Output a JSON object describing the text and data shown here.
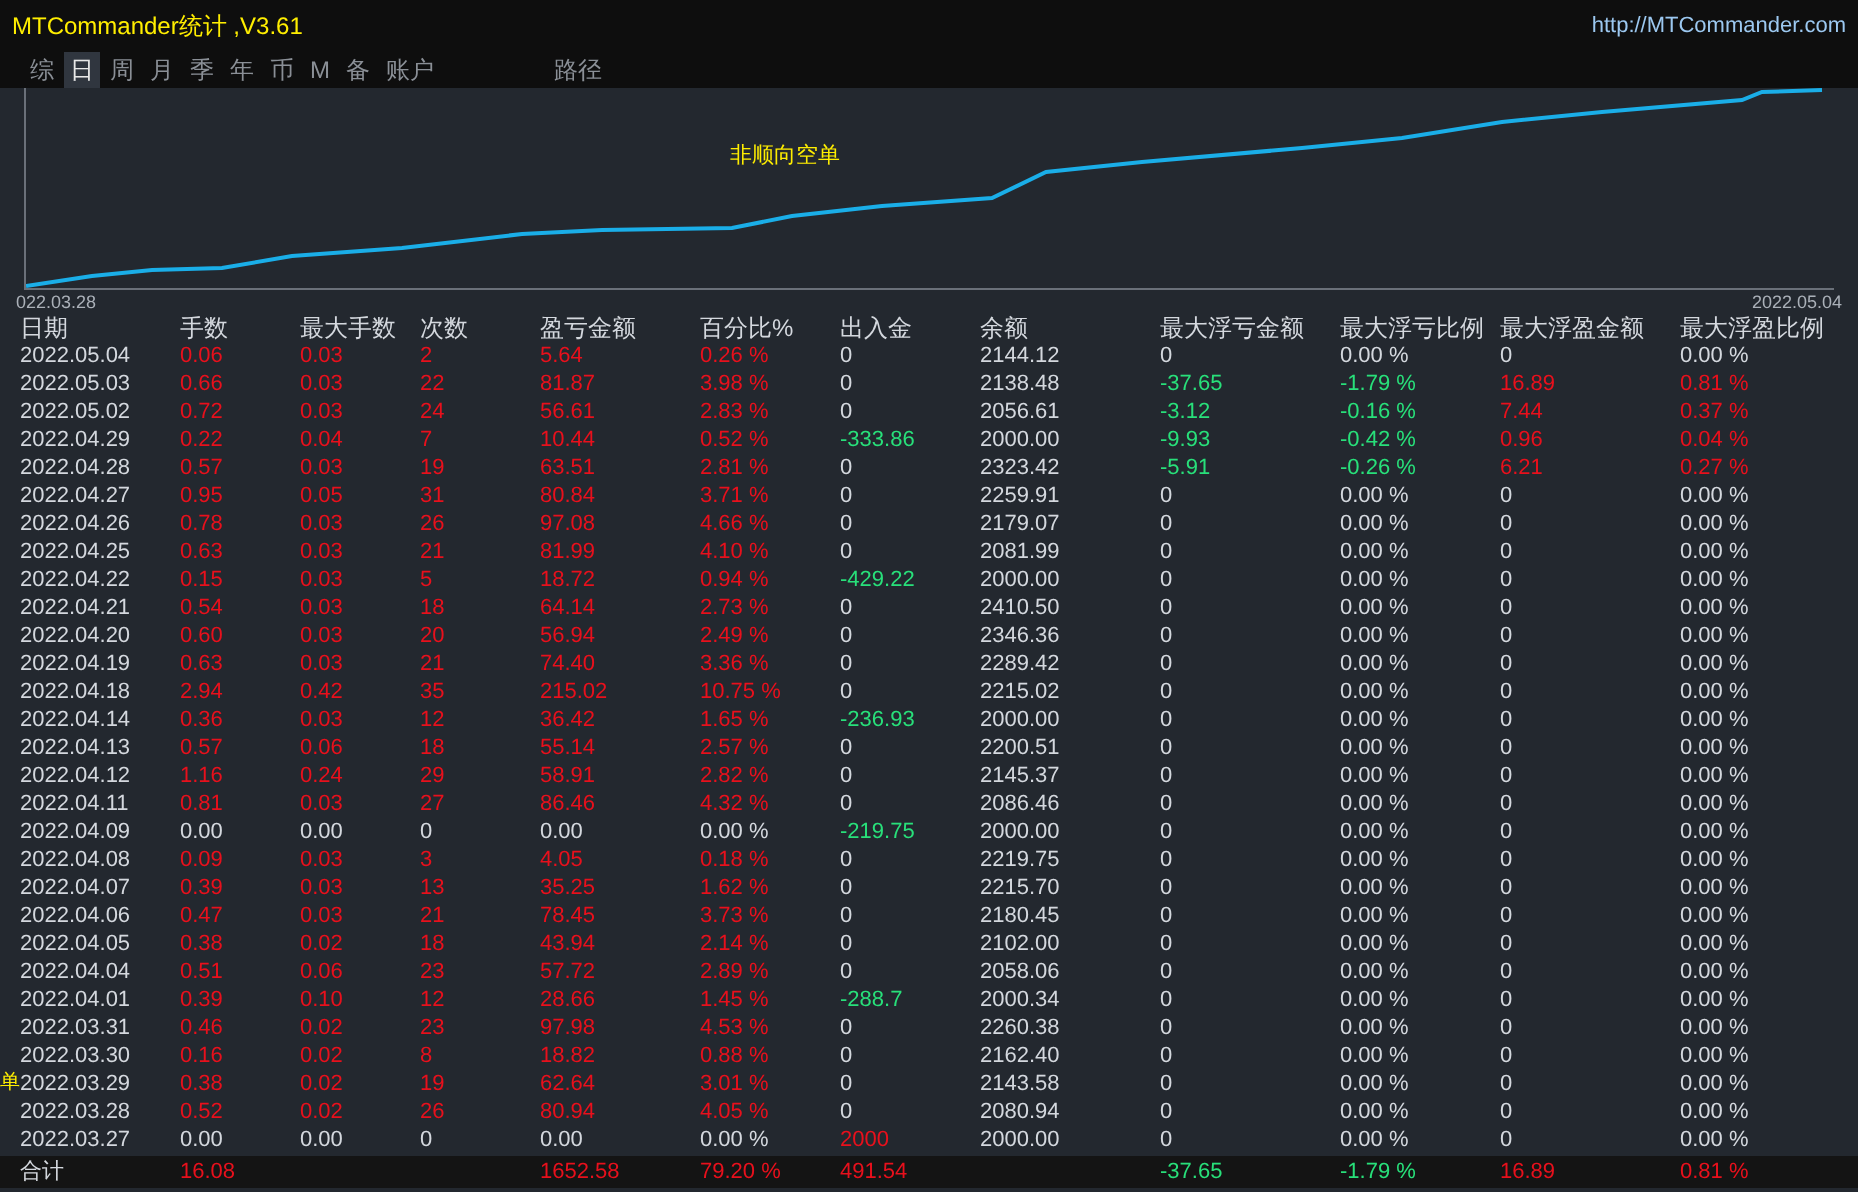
{
  "window": {
    "title": "MTCommander统计 ,V3.61",
    "url": "http://MTCommander.com"
  },
  "tabs": [
    {
      "label": "综",
      "selected": false
    },
    {
      "label": "日",
      "selected": true
    },
    {
      "label": "周",
      "selected": false
    },
    {
      "label": "月",
      "selected": false
    },
    {
      "label": "季",
      "selected": false
    },
    {
      "label": "年",
      "selected": false
    },
    {
      "label": "币",
      "selected": false
    },
    {
      "label": "M",
      "selected": false
    },
    {
      "label": "备",
      "selected": false
    },
    {
      "label": "账户",
      "selected": false
    },
    {
      "label": "路径",
      "selected": false
    }
  ],
  "chart": {
    "title": "非顺向空单",
    "start_date": "022.03.28",
    "end_date": "2022.05.04",
    "side_mark": "单"
  },
  "table": {
    "columns": [
      "日期",
      "手数",
      "最大手数",
      "次数",
      "盈亏金额",
      "百分比%",
      "出入金",
      "余额",
      "最大浮亏金额",
      "最大浮亏比例",
      "最大浮盈金额",
      "最大浮盈比例"
    ],
    "rows": [
      {
        "cells": [
          {
            "text": "2022.05.04",
            "color": "#d4d8de"
          },
          {
            "text": "0.06",
            "color": "#e8101c"
          },
          {
            "text": "0.03",
            "color": "#e8101c"
          },
          {
            "text": "2",
            "color": "#e8101c"
          },
          {
            "text": "5.64",
            "color": "#e8101c"
          },
          {
            "text": "0.26 %",
            "color": "#e8101c"
          },
          {
            "text": "0",
            "color": "#d4d8de"
          },
          {
            "text": "2144.12",
            "color": "#d4d8de"
          },
          {
            "text": "0",
            "color": "#d4d8de"
          },
          {
            "text": "0.00 %",
            "color": "#d4d8de"
          },
          {
            "text": "0",
            "color": "#d4d8de"
          },
          {
            "text": "0.00 %",
            "color": "#d4d8de"
          }
        ]
      },
      {
        "cells": [
          {
            "text": "2022.05.03",
            "color": "#d4d8de"
          },
          {
            "text": "0.66",
            "color": "#e8101c"
          },
          {
            "text": "0.03",
            "color": "#e8101c"
          },
          {
            "text": "22",
            "color": "#e8101c"
          },
          {
            "text": "81.87",
            "color": "#e8101c"
          },
          {
            "text": "3.98 %",
            "color": "#e8101c"
          },
          {
            "text": "0",
            "color": "#d4d8de"
          },
          {
            "text": "2138.48",
            "color": "#d4d8de"
          },
          {
            "text": "-37.65",
            "color": "#28e07a"
          },
          {
            "text": "-1.79 %",
            "color": "#28e07a"
          },
          {
            "text": "16.89",
            "color": "#e8101c"
          },
          {
            "text": "0.81 %",
            "color": "#e8101c"
          }
        ]
      },
      {
        "cells": [
          {
            "text": "2022.05.02",
            "color": "#d4d8de"
          },
          {
            "text": "0.72",
            "color": "#e8101c"
          },
          {
            "text": "0.03",
            "color": "#e8101c"
          },
          {
            "text": "24",
            "color": "#e8101c"
          },
          {
            "text": "56.61",
            "color": "#e8101c"
          },
          {
            "text": "2.83 %",
            "color": "#e8101c"
          },
          {
            "text": "0",
            "color": "#d4d8de"
          },
          {
            "text": "2056.61",
            "color": "#d4d8de"
          },
          {
            "text": "-3.12",
            "color": "#28e07a"
          },
          {
            "text": "-0.16 %",
            "color": "#28e07a"
          },
          {
            "text": "7.44",
            "color": "#e8101c"
          },
          {
            "text": "0.37 %",
            "color": "#e8101c"
          }
        ]
      },
      {
        "cells": [
          {
            "text": "2022.04.29",
            "color": "#d4d8de"
          },
          {
            "text": "0.22",
            "color": "#e8101c"
          },
          {
            "text": "0.04",
            "color": "#e8101c"
          },
          {
            "text": "7",
            "color": "#e8101c"
          },
          {
            "text": "10.44",
            "color": "#e8101c"
          },
          {
            "text": "0.52 %",
            "color": "#e8101c"
          },
          {
            "text": "-333.86",
            "color": "#28e07a"
          },
          {
            "text": "2000.00",
            "color": "#d4d8de"
          },
          {
            "text": "-9.93",
            "color": "#28e07a"
          },
          {
            "text": "-0.42 %",
            "color": "#28e07a"
          },
          {
            "text": "0.96",
            "color": "#e8101c"
          },
          {
            "text": "0.04 %",
            "color": "#e8101c"
          }
        ]
      },
      {
        "cells": [
          {
            "text": "2022.04.28",
            "color": "#d4d8de"
          },
          {
            "text": "0.57",
            "color": "#e8101c"
          },
          {
            "text": "0.03",
            "color": "#e8101c"
          },
          {
            "text": "19",
            "color": "#e8101c"
          },
          {
            "text": "63.51",
            "color": "#e8101c"
          },
          {
            "text": "2.81 %",
            "color": "#e8101c"
          },
          {
            "text": "0",
            "color": "#d4d8de"
          },
          {
            "text": "2323.42",
            "color": "#d4d8de"
          },
          {
            "text": "-5.91",
            "color": "#28e07a"
          },
          {
            "text": "-0.26 %",
            "color": "#28e07a"
          },
          {
            "text": "6.21",
            "color": "#e8101c"
          },
          {
            "text": "0.27 %",
            "color": "#e8101c"
          }
        ]
      },
      {
        "cells": [
          {
            "text": "2022.04.27",
            "color": "#d4d8de"
          },
          {
            "text": "0.95",
            "color": "#e8101c"
          },
          {
            "text": "0.05",
            "color": "#e8101c"
          },
          {
            "text": "31",
            "color": "#e8101c"
          },
          {
            "text": "80.84",
            "color": "#e8101c"
          },
          {
            "text": "3.71 %",
            "color": "#e8101c"
          },
          {
            "text": "0",
            "color": "#d4d8de"
          },
          {
            "text": "2259.91",
            "color": "#d4d8de"
          },
          {
            "text": "0",
            "color": "#d4d8de"
          },
          {
            "text": "0.00 %",
            "color": "#d4d8de"
          },
          {
            "text": "0",
            "color": "#d4d8de"
          },
          {
            "text": "0.00 %",
            "color": "#d4d8de"
          }
        ]
      },
      {
        "cells": [
          {
            "text": "2022.04.26",
            "color": "#d4d8de"
          },
          {
            "text": "0.78",
            "color": "#e8101c"
          },
          {
            "text": "0.03",
            "color": "#e8101c"
          },
          {
            "text": "26",
            "color": "#e8101c"
          },
          {
            "text": "97.08",
            "color": "#e8101c"
          },
          {
            "text": "4.66 %",
            "color": "#e8101c"
          },
          {
            "text": "0",
            "color": "#d4d8de"
          },
          {
            "text": "2179.07",
            "color": "#d4d8de"
          },
          {
            "text": "0",
            "color": "#d4d8de"
          },
          {
            "text": "0.00 %",
            "color": "#d4d8de"
          },
          {
            "text": "0",
            "color": "#d4d8de"
          },
          {
            "text": "0.00 %",
            "color": "#d4d8de"
          }
        ]
      },
      {
        "cells": [
          {
            "text": "2022.04.25",
            "color": "#d4d8de"
          },
          {
            "text": "0.63",
            "color": "#e8101c"
          },
          {
            "text": "0.03",
            "color": "#e8101c"
          },
          {
            "text": "21",
            "color": "#e8101c"
          },
          {
            "text": "81.99",
            "color": "#e8101c"
          },
          {
            "text": "4.10 %",
            "color": "#e8101c"
          },
          {
            "text": "0",
            "color": "#d4d8de"
          },
          {
            "text": "2081.99",
            "color": "#d4d8de"
          },
          {
            "text": "0",
            "color": "#d4d8de"
          },
          {
            "text": "0.00 %",
            "color": "#d4d8de"
          },
          {
            "text": "0",
            "color": "#d4d8de"
          },
          {
            "text": "0.00 %",
            "color": "#d4d8de"
          }
        ]
      },
      {
        "cells": [
          {
            "text": "2022.04.22",
            "color": "#d4d8de"
          },
          {
            "text": "0.15",
            "color": "#e8101c"
          },
          {
            "text": "0.03",
            "color": "#e8101c"
          },
          {
            "text": "5",
            "color": "#e8101c"
          },
          {
            "text": "18.72",
            "color": "#e8101c"
          },
          {
            "text": "0.94 %",
            "color": "#e8101c"
          },
          {
            "text": "-429.22",
            "color": "#28e07a"
          },
          {
            "text": "2000.00",
            "color": "#d4d8de"
          },
          {
            "text": "0",
            "color": "#d4d8de"
          },
          {
            "text": "0.00 %",
            "color": "#d4d8de"
          },
          {
            "text": "0",
            "color": "#d4d8de"
          },
          {
            "text": "0.00 %",
            "color": "#d4d8de"
          }
        ]
      },
      {
        "cells": [
          {
            "text": "2022.04.21",
            "color": "#d4d8de"
          },
          {
            "text": "0.54",
            "color": "#e8101c"
          },
          {
            "text": "0.03",
            "color": "#e8101c"
          },
          {
            "text": "18",
            "color": "#e8101c"
          },
          {
            "text": "64.14",
            "color": "#e8101c"
          },
          {
            "text": "2.73 %",
            "color": "#e8101c"
          },
          {
            "text": "0",
            "color": "#d4d8de"
          },
          {
            "text": "2410.50",
            "color": "#d4d8de"
          },
          {
            "text": "0",
            "color": "#d4d8de"
          },
          {
            "text": "0.00 %",
            "color": "#d4d8de"
          },
          {
            "text": "0",
            "color": "#d4d8de"
          },
          {
            "text": "0.00 %",
            "color": "#d4d8de"
          }
        ]
      },
      {
        "cells": [
          {
            "text": "2022.04.20",
            "color": "#d4d8de"
          },
          {
            "text": "0.60",
            "color": "#e8101c"
          },
          {
            "text": "0.03",
            "color": "#e8101c"
          },
          {
            "text": "20",
            "color": "#e8101c"
          },
          {
            "text": "56.94",
            "color": "#e8101c"
          },
          {
            "text": "2.49 %",
            "color": "#e8101c"
          },
          {
            "text": "0",
            "color": "#d4d8de"
          },
          {
            "text": "2346.36",
            "color": "#d4d8de"
          },
          {
            "text": "0",
            "color": "#d4d8de"
          },
          {
            "text": "0.00 %",
            "color": "#d4d8de"
          },
          {
            "text": "0",
            "color": "#d4d8de"
          },
          {
            "text": "0.00 %",
            "color": "#d4d8de"
          }
        ]
      },
      {
        "cells": [
          {
            "text": "2022.04.19",
            "color": "#d4d8de"
          },
          {
            "text": "0.63",
            "color": "#e8101c"
          },
          {
            "text": "0.03",
            "color": "#e8101c"
          },
          {
            "text": "21",
            "color": "#e8101c"
          },
          {
            "text": "74.40",
            "color": "#e8101c"
          },
          {
            "text": "3.36 %",
            "color": "#e8101c"
          },
          {
            "text": "0",
            "color": "#d4d8de"
          },
          {
            "text": "2289.42",
            "color": "#d4d8de"
          },
          {
            "text": "0",
            "color": "#d4d8de"
          },
          {
            "text": "0.00 %",
            "color": "#d4d8de"
          },
          {
            "text": "0",
            "color": "#d4d8de"
          },
          {
            "text": "0.00 %",
            "color": "#d4d8de"
          }
        ]
      },
      {
        "cells": [
          {
            "text": "2022.04.18",
            "color": "#d4d8de"
          },
          {
            "text": "2.94",
            "color": "#e8101c"
          },
          {
            "text": "0.42",
            "color": "#e8101c"
          },
          {
            "text": "35",
            "color": "#e8101c"
          },
          {
            "text": "215.02",
            "color": "#e8101c"
          },
          {
            "text": "10.75 %",
            "color": "#e8101c"
          },
          {
            "text": "0",
            "color": "#d4d8de"
          },
          {
            "text": "2215.02",
            "color": "#d4d8de"
          },
          {
            "text": "0",
            "color": "#d4d8de"
          },
          {
            "text": "0.00 %",
            "color": "#d4d8de"
          },
          {
            "text": "0",
            "color": "#d4d8de"
          },
          {
            "text": "0.00 %",
            "color": "#d4d8de"
          }
        ]
      },
      {
        "cells": [
          {
            "text": "2022.04.14",
            "color": "#d4d8de"
          },
          {
            "text": "0.36",
            "color": "#e8101c"
          },
          {
            "text": "0.03",
            "color": "#e8101c"
          },
          {
            "text": "12",
            "color": "#e8101c"
          },
          {
            "text": "36.42",
            "color": "#e8101c"
          },
          {
            "text": "1.65 %",
            "color": "#e8101c"
          },
          {
            "text": "-236.93",
            "color": "#28e07a"
          },
          {
            "text": "2000.00",
            "color": "#d4d8de"
          },
          {
            "text": "0",
            "color": "#d4d8de"
          },
          {
            "text": "0.00 %",
            "color": "#d4d8de"
          },
          {
            "text": "0",
            "color": "#d4d8de"
          },
          {
            "text": "0.00 %",
            "color": "#d4d8de"
          }
        ]
      },
      {
        "cells": [
          {
            "text": "2022.04.13",
            "color": "#d4d8de"
          },
          {
            "text": "0.57",
            "color": "#e8101c"
          },
          {
            "text": "0.06",
            "color": "#e8101c"
          },
          {
            "text": "18",
            "color": "#e8101c"
          },
          {
            "text": "55.14",
            "color": "#e8101c"
          },
          {
            "text": "2.57 %",
            "color": "#e8101c"
          },
          {
            "text": "0",
            "color": "#d4d8de"
          },
          {
            "text": "2200.51",
            "color": "#d4d8de"
          },
          {
            "text": "0",
            "color": "#d4d8de"
          },
          {
            "text": "0.00 %",
            "color": "#d4d8de"
          },
          {
            "text": "0",
            "color": "#d4d8de"
          },
          {
            "text": "0.00 %",
            "color": "#d4d8de"
          }
        ]
      },
      {
        "cells": [
          {
            "text": "2022.04.12",
            "color": "#d4d8de"
          },
          {
            "text": "1.16",
            "color": "#e8101c"
          },
          {
            "text": "0.24",
            "color": "#e8101c"
          },
          {
            "text": "29",
            "color": "#e8101c"
          },
          {
            "text": "58.91",
            "color": "#e8101c"
          },
          {
            "text": "2.82 %",
            "color": "#e8101c"
          },
          {
            "text": "0",
            "color": "#d4d8de"
          },
          {
            "text": "2145.37",
            "color": "#d4d8de"
          },
          {
            "text": "0",
            "color": "#d4d8de"
          },
          {
            "text": "0.00 %",
            "color": "#d4d8de"
          },
          {
            "text": "0",
            "color": "#d4d8de"
          },
          {
            "text": "0.00 %",
            "color": "#d4d8de"
          }
        ]
      },
      {
        "cells": [
          {
            "text": "2022.04.11",
            "color": "#d4d8de"
          },
          {
            "text": "0.81",
            "color": "#e8101c"
          },
          {
            "text": "0.03",
            "color": "#e8101c"
          },
          {
            "text": "27",
            "color": "#e8101c"
          },
          {
            "text": "86.46",
            "color": "#e8101c"
          },
          {
            "text": "4.32 %",
            "color": "#e8101c"
          },
          {
            "text": "0",
            "color": "#d4d8de"
          },
          {
            "text": "2086.46",
            "color": "#d4d8de"
          },
          {
            "text": "0",
            "color": "#d4d8de"
          },
          {
            "text": "0.00 %",
            "color": "#d4d8de"
          },
          {
            "text": "0",
            "color": "#d4d8de"
          },
          {
            "text": "0.00 %",
            "color": "#d4d8de"
          }
        ]
      },
      {
        "cells": [
          {
            "text": "2022.04.09",
            "color": "#d4d8de"
          },
          {
            "text": "0.00",
            "color": "#d4d8de"
          },
          {
            "text": "0.00",
            "color": "#d4d8de"
          },
          {
            "text": "0",
            "color": "#d4d8de"
          },
          {
            "text": "0.00",
            "color": "#d4d8de"
          },
          {
            "text": "0.00 %",
            "color": "#d4d8de"
          },
          {
            "text": "-219.75",
            "color": "#28e07a"
          },
          {
            "text": "2000.00",
            "color": "#d4d8de"
          },
          {
            "text": "0",
            "color": "#d4d8de"
          },
          {
            "text": "0.00 %",
            "color": "#d4d8de"
          },
          {
            "text": "0",
            "color": "#d4d8de"
          },
          {
            "text": "0.00 %",
            "color": "#d4d8de"
          }
        ]
      },
      {
        "cells": [
          {
            "text": "2022.04.08",
            "color": "#d4d8de"
          },
          {
            "text": "0.09",
            "color": "#e8101c"
          },
          {
            "text": "0.03",
            "color": "#e8101c"
          },
          {
            "text": "3",
            "color": "#e8101c"
          },
          {
            "text": "4.05",
            "color": "#e8101c"
          },
          {
            "text": "0.18 %",
            "color": "#e8101c"
          },
          {
            "text": "0",
            "color": "#d4d8de"
          },
          {
            "text": "2219.75",
            "color": "#d4d8de"
          },
          {
            "text": "0",
            "color": "#d4d8de"
          },
          {
            "text": "0.00 %",
            "color": "#d4d8de"
          },
          {
            "text": "0",
            "color": "#d4d8de"
          },
          {
            "text": "0.00 %",
            "color": "#d4d8de"
          }
        ]
      },
      {
        "cells": [
          {
            "text": "2022.04.07",
            "color": "#d4d8de"
          },
          {
            "text": "0.39",
            "color": "#e8101c"
          },
          {
            "text": "0.03",
            "color": "#e8101c"
          },
          {
            "text": "13",
            "color": "#e8101c"
          },
          {
            "text": "35.25",
            "color": "#e8101c"
          },
          {
            "text": "1.62 %",
            "color": "#e8101c"
          },
          {
            "text": "0",
            "color": "#d4d8de"
          },
          {
            "text": "2215.70",
            "color": "#d4d8de"
          },
          {
            "text": "0",
            "color": "#d4d8de"
          },
          {
            "text": "0.00 %",
            "color": "#d4d8de"
          },
          {
            "text": "0",
            "color": "#d4d8de"
          },
          {
            "text": "0.00 %",
            "color": "#d4d8de"
          }
        ]
      },
      {
        "cells": [
          {
            "text": "2022.04.06",
            "color": "#d4d8de"
          },
          {
            "text": "0.47",
            "color": "#e8101c"
          },
          {
            "text": "0.03",
            "color": "#e8101c"
          },
          {
            "text": "21",
            "color": "#e8101c"
          },
          {
            "text": "78.45",
            "color": "#e8101c"
          },
          {
            "text": "3.73 %",
            "color": "#e8101c"
          },
          {
            "text": "0",
            "color": "#d4d8de"
          },
          {
            "text": "2180.45",
            "color": "#d4d8de"
          },
          {
            "text": "0",
            "color": "#d4d8de"
          },
          {
            "text": "0.00 %",
            "color": "#d4d8de"
          },
          {
            "text": "0",
            "color": "#d4d8de"
          },
          {
            "text": "0.00 %",
            "color": "#d4d8de"
          }
        ]
      },
      {
        "cells": [
          {
            "text": "2022.04.05",
            "color": "#d4d8de"
          },
          {
            "text": "0.38",
            "color": "#e8101c"
          },
          {
            "text": "0.02",
            "color": "#e8101c"
          },
          {
            "text": "18",
            "color": "#e8101c"
          },
          {
            "text": "43.94",
            "color": "#e8101c"
          },
          {
            "text": "2.14 %",
            "color": "#e8101c"
          },
          {
            "text": "0",
            "color": "#d4d8de"
          },
          {
            "text": "2102.00",
            "color": "#d4d8de"
          },
          {
            "text": "0",
            "color": "#d4d8de"
          },
          {
            "text": "0.00 %",
            "color": "#d4d8de"
          },
          {
            "text": "0",
            "color": "#d4d8de"
          },
          {
            "text": "0.00 %",
            "color": "#d4d8de"
          }
        ]
      },
      {
        "cells": [
          {
            "text": "2022.04.04",
            "color": "#d4d8de"
          },
          {
            "text": "0.51",
            "color": "#e8101c"
          },
          {
            "text": "0.06",
            "color": "#e8101c"
          },
          {
            "text": "23",
            "color": "#e8101c"
          },
          {
            "text": "57.72",
            "color": "#e8101c"
          },
          {
            "text": "2.89 %",
            "color": "#e8101c"
          },
          {
            "text": "0",
            "color": "#d4d8de"
          },
          {
            "text": "2058.06",
            "color": "#d4d8de"
          },
          {
            "text": "0",
            "color": "#d4d8de"
          },
          {
            "text": "0.00 %",
            "color": "#d4d8de"
          },
          {
            "text": "0",
            "color": "#d4d8de"
          },
          {
            "text": "0.00 %",
            "color": "#d4d8de"
          }
        ]
      },
      {
        "cells": [
          {
            "text": "2022.04.01",
            "color": "#d4d8de"
          },
          {
            "text": "0.39",
            "color": "#e8101c"
          },
          {
            "text": "0.10",
            "color": "#e8101c"
          },
          {
            "text": "12",
            "color": "#e8101c"
          },
          {
            "text": "28.66",
            "color": "#e8101c"
          },
          {
            "text": "1.45 %",
            "color": "#e8101c"
          },
          {
            "text": "-288.7",
            "color": "#28e07a"
          },
          {
            "text": "2000.34",
            "color": "#d4d8de"
          },
          {
            "text": "0",
            "color": "#d4d8de"
          },
          {
            "text": "0.00 %",
            "color": "#d4d8de"
          },
          {
            "text": "0",
            "color": "#d4d8de"
          },
          {
            "text": "0.00 %",
            "color": "#d4d8de"
          }
        ]
      },
      {
        "cells": [
          {
            "text": "2022.03.31",
            "color": "#d4d8de"
          },
          {
            "text": "0.46",
            "color": "#e8101c"
          },
          {
            "text": "0.02",
            "color": "#e8101c"
          },
          {
            "text": "23",
            "color": "#e8101c"
          },
          {
            "text": "97.98",
            "color": "#e8101c"
          },
          {
            "text": "4.53 %",
            "color": "#e8101c"
          },
          {
            "text": "0",
            "color": "#d4d8de"
          },
          {
            "text": "2260.38",
            "color": "#d4d8de"
          },
          {
            "text": "0",
            "color": "#d4d8de"
          },
          {
            "text": "0.00 %",
            "color": "#d4d8de"
          },
          {
            "text": "0",
            "color": "#d4d8de"
          },
          {
            "text": "0.00 %",
            "color": "#d4d8de"
          }
        ]
      },
      {
        "cells": [
          {
            "text": "2022.03.30",
            "color": "#d4d8de"
          },
          {
            "text": "0.16",
            "color": "#e8101c"
          },
          {
            "text": "0.02",
            "color": "#e8101c"
          },
          {
            "text": "8",
            "color": "#e8101c"
          },
          {
            "text": "18.82",
            "color": "#e8101c"
          },
          {
            "text": "0.88 %",
            "color": "#e8101c"
          },
          {
            "text": "0",
            "color": "#d4d8de"
          },
          {
            "text": "2162.40",
            "color": "#d4d8de"
          },
          {
            "text": "0",
            "color": "#d4d8de"
          },
          {
            "text": "0.00 %",
            "color": "#d4d8de"
          },
          {
            "text": "0",
            "color": "#d4d8de"
          },
          {
            "text": "0.00 %",
            "color": "#d4d8de"
          }
        ]
      },
      {
        "cells": [
          {
            "text": "2022.03.29",
            "color": "#d4d8de"
          },
          {
            "text": "0.38",
            "color": "#e8101c"
          },
          {
            "text": "0.02",
            "color": "#e8101c"
          },
          {
            "text": "19",
            "color": "#e8101c"
          },
          {
            "text": "62.64",
            "color": "#e8101c"
          },
          {
            "text": "3.01 %",
            "color": "#e8101c"
          },
          {
            "text": "0",
            "color": "#d4d8de"
          },
          {
            "text": "2143.58",
            "color": "#d4d8de"
          },
          {
            "text": "0",
            "color": "#d4d8de"
          },
          {
            "text": "0.00 %",
            "color": "#d4d8de"
          },
          {
            "text": "0",
            "color": "#d4d8de"
          },
          {
            "text": "0.00 %",
            "color": "#d4d8de"
          }
        ]
      },
      {
        "cells": [
          {
            "text": "2022.03.28",
            "color": "#d4d8de"
          },
          {
            "text": "0.52",
            "color": "#e8101c"
          },
          {
            "text": "0.02",
            "color": "#e8101c"
          },
          {
            "text": "26",
            "color": "#e8101c"
          },
          {
            "text": "80.94",
            "color": "#e8101c"
          },
          {
            "text": "4.05 %",
            "color": "#e8101c"
          },
          {
            "text": "0",
            "color": "#d4d8de"
          },
          {
            "text": "2080.94",
            "color": "#d4d8de"
          },
          {
            "text": "0",
            "color": "#d4d8de"
          },
          {
            "text": "0.00 %",
            "color": "#d4d8de"
          },
          {
            "text": "0",
            "color": "#d4d8de"
          },
          {
            "text": "0.00 %",
            "color": "#d4d8de"
          }
        ]
      },
      {
        "cells": [
          {
            "text": "2022.03.27",
            "color": "#d4d8de"
          },
          {
            "text": "0.00",
            "color": "#d4d8de"
          },
          {
            "text": "0.00",
            "color": "#d4d8de"
          },
          {
            "text": "0",
            "color": "#d4d8de"
          },
          {
            "text": "0.00",
            "color": "#d4d8de"
          },
          {
            "text": "0.00 %",
            "color": "#d4d8de"
          },
          {
            "text": "2000",
            "color": "#e8101c"
          },
          {
            "text": "2000.00",
            "color": "#d4d8de"
          },
          {
            "text": "0",
            "color": "#d4d8de"
          },
          {
            "text": "0.00 %",
            "color": "#d4d8de"
          },
          {
            "text": "0",
            "color": "#d4d8de"
          },
          {
            "text": "0.00 %",
            "color": "#d4d8de"
          }
        ]
      }
    ],
    "total": {
      "cells": [
        {
          "text": "合计",
          "color": "#d4d8de"
        },
        {
          "text": "16.08",
          "color": "#e8101c"
        },
        null,
        null,
        {
          "text": "1652.58",
          "color": "#e8101c"
        },
        {
          "text": "79.20 %",
          "color": "#e8101c"
        },
        {
          "text": "491.54",
          "color": "#e8101c"
        },
        null,
        {
          "text": "-37.65",
          "color": "#28e07a"
        },
        {
          "text": "-1.79 %",
          "color": "#28e07a"
        },
        {
          "text": "16.89",
          "color": "#e8101c"
        },
        {
          "text": "0.81 %",
          "color": "#e8101c"
        }
      ]
    }
  }
}
